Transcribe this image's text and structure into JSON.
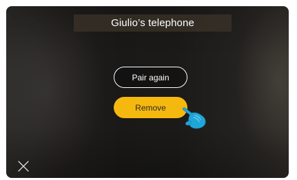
{
  "screen": {
    "title": "Giulio’s telephone"
  },
  "actions": {
    "pair_again_label": "Pair again",
    "remove_label": "Remove"
  },
  "icons": {
    "close": "close-icon",
    "pointer": "pointing-hand-icon"
  },
  "colors": {
    "accent": "#f5b80f",
    "pointer": "#1fa6d9",
    "title_bar": "#3a3228"
  }
}
